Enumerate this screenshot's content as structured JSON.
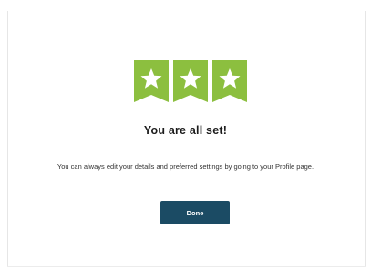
{
  "dialog": {
    "badges": [
      {
        "icon": "star-icon",
        "color": "#8cbf3f"
      },
      {
        "icon": "star-icon",
        "color": "#8cbf3f"
      },
      {
        "icon": "star-icon",
        "color": "#8cbf3f"
      }
    ],
    "title": "You are all set!",
    "message": "You can always edit your details and preferred settings by going to your Profile page.",
    "done_label": "Done"
  },
  "colors": {
    "badge_green": "#8cbf3f",
    "button_bg": "#1b4b64",
    "button_text": "#ffffff"
  }
}
